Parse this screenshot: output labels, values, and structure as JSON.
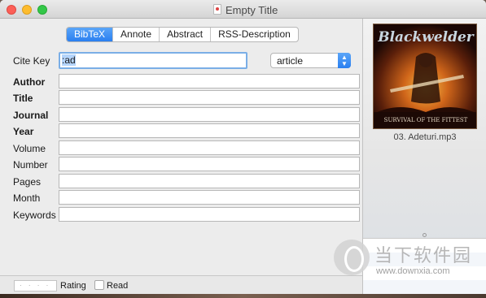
{
  "window": {
    "title": "Empty Title"
  },
  "tabs": [
    {
      "label": "BibTeX",
      "active": true
    },
    {
      "label": "Annote",
      "active": false
    },
    {
      "label": "Abstract",
      "active": false
    },
    {
      "label": "RSS-Description",
      "active": false
    }
  ],
  "cite": {
    "label": "Cite Key",
    "value": ":ad"
  },
  "entry_type": {
    "selected": "article"
  },
  "fields": [
    {
      "label": "Author",
      "bold": true,
      "value": ""
    },
    {
      "label": "Title",
      "bold": true,
      "value": ""
    },
    {
      "label": "Journal",
      "bold": true,
      "value": ""
    },
    {
      "label": "Year",
      "bold": true,
      "value": ""
    },
    {
      "label": "Volume",
      "bold": false,
      "value": ""
    },
    {
      "label": "Number",
      "bold": false,
      "value": ""
    },
    {
      "label": "Pages",
      "bold": false,
      "value": ""
    },
    {
      "label": "Month",
      "bold": false,
      "value": ""
    },
    {
      "label": "Keywords",
      "bold": false,
      "value": ""
    }
  ],
  "status": {
    "rating_label": "Rating",
    "rating_value": 0,
    "read_label": "Read",
    "read_checked": false
  },
  "attachment": {
    "band": "Blackwelder",
    "album_title": "SURVIVAL OF THE FITTEST",
    "filename": "03. Adeturi.mp3"
  },
  "watermark": {
    "text_cn": "当下软件园",
    "url": "www.downxia.com"
  },
  "colors": {
    "accent": "#2a7ff0",
    "window_bg": "#ececec",
    "close": "#fc5f57",
    "minimize": "#fdbc2e",
    "zoom": "#33c748"
  }
}
